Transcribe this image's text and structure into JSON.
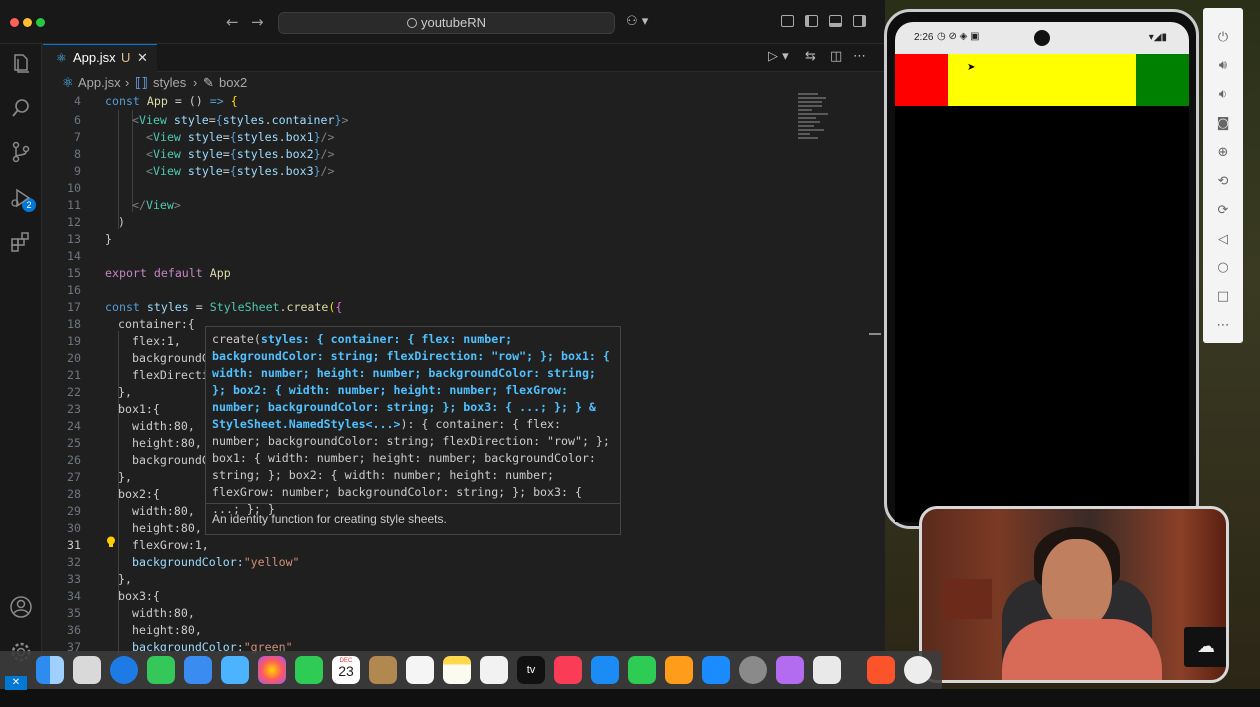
{
  "window": {
    "search_label": "youtubeRN"
  },
  "tab": {
    "name": "App.jsx",
    "modified": "U",
    "close": "✕"
  },
  "breadcrumb": {
    "file": "App.jsx",
    "styles": "styles",
    "box2": "box2"
  },
  "scm_badge": "2",
  "code_lines": [
    {
      "n": "4"
    },
    {
      "n": "6"
    },
    {
      "n": "7"
    },
    {
      "n": "8"
    },
    {
      "n": "9"
    },
    {
      "n": "10"
    },
    {
      "n": "11"
    },
    {
      "n": "12"
    },
    {
      "n": "13"
    },
    {
      "n": "14"
    },
    {
      "n": "15"
    },
    {
      "n": "16"
    },
    {
      "n": "17"
    },
    {
      "n": "18"
    },
    {
      "n": "19"
    },
    {
      "n": "20"
    },
    {
      "n": "21"
    },
    {
      "n": "22"
    },
    {
      "n": "23"
    },
    {
      "n": "24"
    },
    {
      "n": "25"
    },
    {
      "n": "26"
    },
    {
      "n": "27"
    },
    {
      "n": "28"
    },
    {
      "n": "29"
    },
    {
      "n": "30"
    },
    {
      "n": "31"
    },
    {
      "n": "32"
    },
    {
      "n": "33"
    },
    {
      "n": "34"
    },
    {
      "n": "35"
    },
    {
      "n": "36"
    },
    {
      "n": "37"
    }
  ],
  "code": {
    "l4": "const App = () => {",
    "l6_tag": "View",
    "l6_attr": "style",
    "l6_val": "{styles.container}",
    "l7": "<View style={styles.box1}/>",
    "l8": "<View style={styles.box2}/>",
    "l9": "<View style={styles.box3}/>",
    "l11": "</View>",
    "l12": ")",
    "l13": "}",
    "l15": "export default App",
    "l17": "const styles = StyleSheet.create({",
    "l18": "container:{",
    "l19": "flex:1,",
    "l20": "backgroundC",
    "l21": "flexDirecti",
    "l22": "},",
    "l23": "box1:{",
    "l24": "width:80,",
    "l25": "height:80,",
    "l26": "backgroundC",
    "l27": "},",
    "l28": "box2:{",
    "l29": "width:80,",
    "l30": "height:80,",
    "l31": "flexGrow:1,",
    "l32_key": "backgroundColor:",
    "l32_val": "\"yellow\"",
    "l33": "},",
    "l34": "box3:{",
    "l35": "width:80,",
    "l36": "height:80,",
    "l37_key": "backgroundColor:",
    "l37_val": "\"green\""
  },
  "hover": {
    "sig_prefix": "create(",
    "sig_highlight": "styles: { container: { flex: number; backgroundColor: string; flexDirection: \"row\"; }; box1: { width: number; height: number; backgroundColor: string; }; box2: { width: number; height: number; flexGrow: number; backgroundColor: string; }; box3: { ...; }; } & StyleSheet.NamedStyles<...>",
    "sig_suffix": "): { container: { flex: number; backgroundColor: string; flexDirection: \"row\"; }; box1: { width: number; height: number; backgroundColor: string; }; box2: { width: number; height: number; flexGrow: number; backgroundColor: string; }; box3: { ...; }; }",
    "doc": "An identity function for creating style sheets."
  },
  "phone": {
    "time": "2:26",
    "boxes": [
      {
        "color": "#ff0000",
        "grow": 0
      },
      {
        "color": "#ffff00",
        "grow": 1
      },
      {
        "color": "#008000",
        "grow": 0
      }
    ]
  },
  "dock": {
    "calendar_month": "DEC",
    "calendar_day": "23",
    "tv_label": "tv"
  },
  "colors": {
    "accent": "#0078d4",
    "editor_bg": "#1f1f1f"
  }
}
